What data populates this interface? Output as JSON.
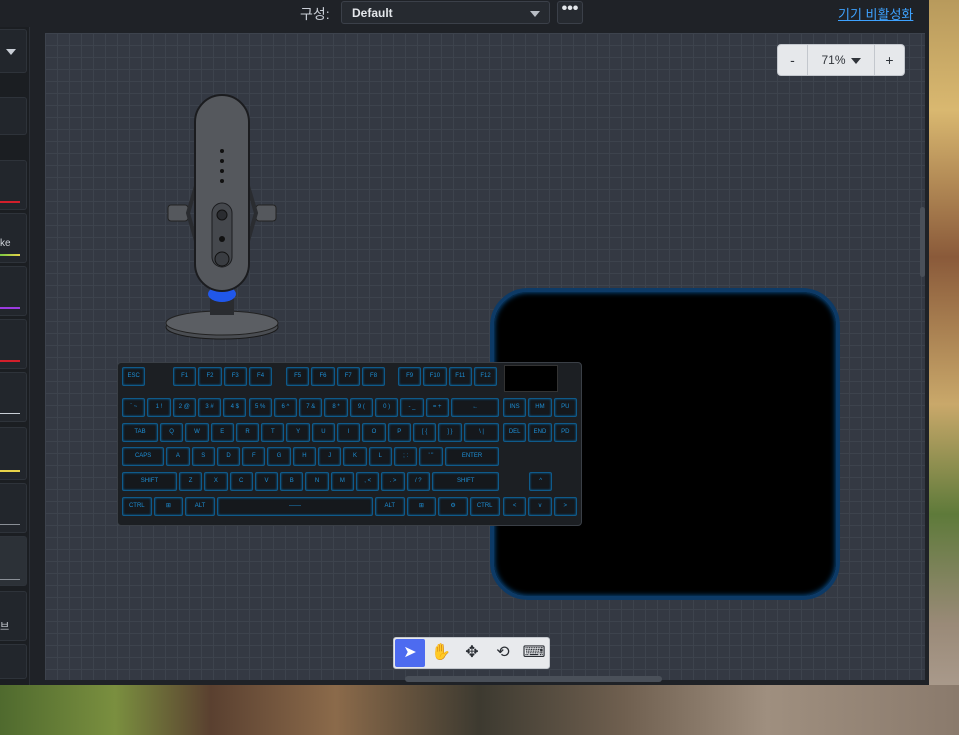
{
  "header": {
    "config_label": "구성:",
    "config_value": "Default",
    "more_label": "•••",
    "disable_link": "기기 비활성화"
  },
  "sidebar": {
    "partial_labels": [
      "ke",
      "브"
    ],
    "accent_colors": [
      "#d21f2b",
      "#7ac943",
      "#9b3be0",
      "#d21f2b",
      "#c9ced6",
      "#e8d34a",
      "#8a8f96",
      "#8a8f96"
    ]
  },
  "zoom": {
    "minus": "-",
    "value": "71%",
    "plus": "+"
  },
  "devices": {
    "microphone": {
      "icon": "microphone-icon",
      "accent": "#1f5cff"
    },
    "keyboard": {
      "row_fn": [
        "ESC",
        "F1",
        "F2",
        "F3",
        "F4",
        "F5",
        "F6",
        "F7",
        "F8",
        "F9",
        "F10",
        "F11",
        "F12"
      ],
      "row_num": [
        "` ~",
        "1 !",
        "2 @",
        "3 #",
        "4 $",
        "5 %",
        "6 ^",
        "7 &",
        "8 *",
        "9 (",
        "0 )",
        "- _",
        "= +",
        "←",
        "INS",
        "HM",
        "PU"
      ],
      "row_top": [
        "TAB",
        "Q",
        "W",
        "E",
        "R",
        "T",
        "Y",
        "U",
        "I",
        "O",
        "P",
        "[ {",
        "] }",
        "\\ |",
        "DEL",
        "END",
        "PD"
      ],
      "row_home": [
        "CAPS",
        "A",
        "S",
        "D",
        "F",
        "G",
        "H",
        "J",
        "K",
        "L",
        "; :",
        "' \"",
        "ENTER"
      ],
      "row_bottom": [
        "SHIFT",
        "Z",
        "X",
        "C",
        "V",
        "B",
        "N",
        "M",
        ", <",
        ". >",
        "/ ?",
        "SHIFT",
        "^"
      ],
      "row_space": [
        "CTRL",
        "⊞",
        "ALT",
        "——",
        "ALT",
        "⊞",
        "⚙",
        "CTRL",
        "<",
        "v",
        ">"
      ]
    },
    "mousepad": {
      "accent": "#0d5fa8"
    }
  },
  "toolbar": {
    "select_icon": "cursor-icon",
    "pan_icon": "hand-icon",
    "move_icon": "move-arrows-icon",
    "rotate_icon": "rotate-icon",
    "keyboard_icon": "keyboard-icon",
    "select_glyph": "➤",
    "pan_glyph": "✋",
    "move_glyph": "✥",
    "rotate_glyph": "⟲",
    "keyboard_glyph": "⌨"
  }
}
